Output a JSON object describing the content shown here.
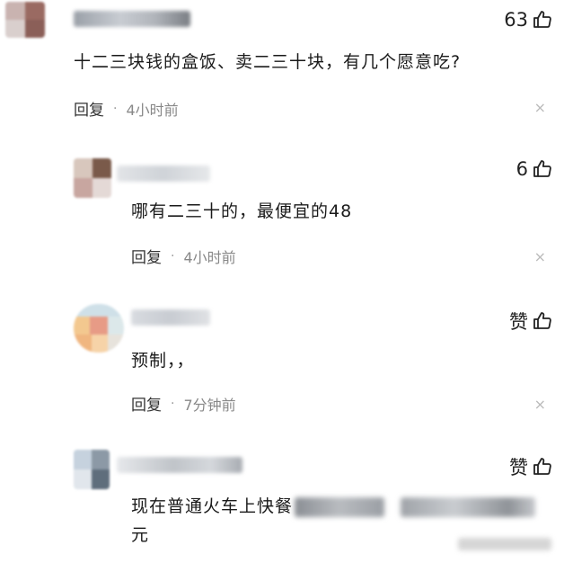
{
  "comments": [
    {
      "likes": "63",
      "text": "十二三块钱的盒饭、卖二三十块，有几个愿意吃?",
      "reply_label": "回复",
      "dot": "·",
      "time": "4小时前",
      "close": "×"
    },
    {
      "likes": "6",
      "text": "哪有二三十的，最便宜的48",
      "reply_label": "回复",
      "dot": "·",
      "time": "4小时前",
      "close": "×"
    },
    {
      "likes": "赞",
      "text": "预制，，",
      "reply_label": "回复",
      "dot": "·",
      "time": "7分钟前",
      "close": "×"
    },
    {
      "likes": "赞",
      "text_visible": "现在普通火车上快餐",
      "text_line2": "元"
    }
  ],
  "colors": {
    "background": "#ffffff",
    "text": "#1a1a1a",
    "meta": "#888888",
    "close": "#bbbbbb"
  },
  "icons": [
    "thumbs-up-icon",
    "close-icon"
  ]
}
